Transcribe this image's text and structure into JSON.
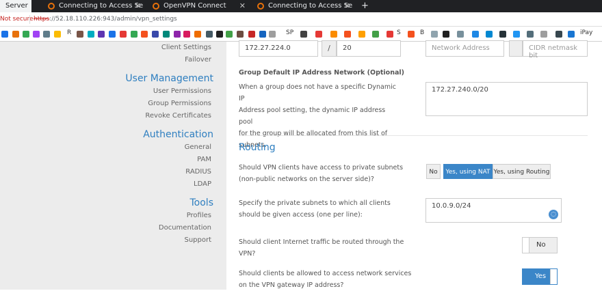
{
  "browser": {
    "tabs": [
      {
        "title": "Server",
        "active": true
      },
      {
        "title": "Connecting to Access Se",
        "active": false
      },
      {
        "title": "OpenVPN Connect",
        "active": false
      },
      {
        "title": "Connecting to Access Se",
        "active": false
      }
    ],
    "new_tab_label": "+",
    "security_label": "Not secure",
    "url_scheme": "https",
    "url_rest": "://52.18.110.226:943/admin/vpn_settings",
    "bookmark_text": [
      "R",
      "SP",
      "S",
      "B",
      "iPay"
    ]
  },
  "sidebar": {
    "links_top": [
      "Client Settings",
      "Failover"
    ],
    "user_management": {
      "heading": "User Management",
      "items": [
        "User Permissions",
        "Group Permissions",
        "Revoke Certificates"
      ]
    },
    "authentication": {
      "heading": "Authentication",
      "items": [
        "General",
        "PAM",
        "RADIUS",
        "LDAP"
      ]
    },
    "tools": {
      "heading": "Tools",
      "items": [
        "Profiles",
        "Documentation",
        "Support"
      ]
    }
  },
  "main": {
    "network_row": {
      "address": "172.27.224.0",
      "slash": "/",
      "netmask": "20",
      "address_placeholder": "Network Address",
      "netmask_placeholder": "CIDR netmask bit"
    },
    "group_default": {
      "label": "Group Default IP Address Network (Optional)",
      "description_lines": [
        "When a group does not have a specific Dynamic IP",
        "Address pool setting, the dynamic IP address pool",
        "for the group will be allocated from this list of",
        "subnets."
      ],
      "value": "172.27.240.0/20"
    },
    "routing": {
      "heading": "Routing",
      "private_access": {
        "question_lines": [
          "Should VPN clients have access to private subnets",
          "(non-public networks on the server side)?"
        ],
        "options": [
          "No",
          "Yes, using NAT",
          "Yes, using Routing"
        ],
        "selected": "Yes, using NAT"
      },
      "subnets": {
        "question_lines": [
          "Specify the private subnets to which all clients",
          "should be given access (one per line):"
        ],
        "value": "10.0.9.0/24"
      },
      "internet_traffic": {
        "question_lines": [
          "Should client Internet traffic be routed through the",
          "VPN?"
        ],
        "toggle_label": "No"
      },
      "gateway_access": {
        "question_lines": [
          "Should clients be allowed to access network services",
          "on the VPN gateway IP address?"
        ],
        "toggle_label": "Yes"
      }
    }
  },
  "colors": {
    "accent": "#2f7fc0",
    "selected": "#3b86c8",
    "sidebar_bg": "#ececec"
  }
}
